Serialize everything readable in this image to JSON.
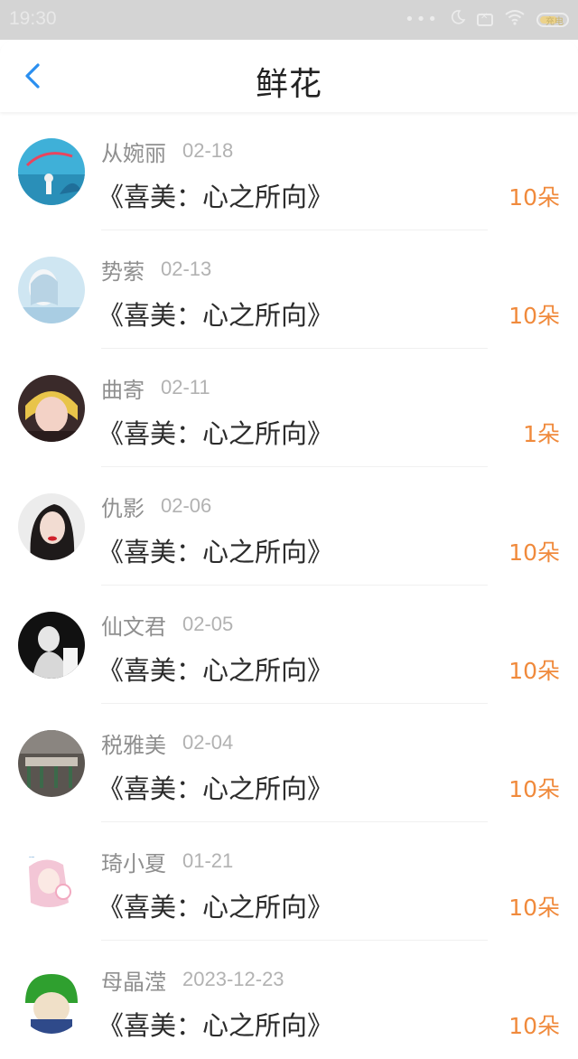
{
  "status_bar": {
    "time": "19:30",
    "icons": [
      "more-dots-icon",
      "moon-icon",
      "sim-off-icon",
      "wifi-icon",
      "battery-icon"
    ],
    "battery_label": "充电"
  },
  "header": {
    "title": "鲜花",
    "back_icon": "chevron-left-icon",
    "accent_color": "#2a8ff0"
  },
  "colors": {
    "amount": "#f08a3c",
    "name": "#8f8f8f",
    "date": "#b2b2b2"
  },
  "items": [
    {
      "name": "从婉丽",
      "date": "02-18",
      "title": "《喜美：心之所向》",
      "amount": "10朵"
    },
    {
      "name": "势萦",
      "date": "02-13",
      "title": "《喜美：心之所向》",
      "amount": "10朵"
    },
    {
      "name": "曲寄",
      "date": "02-11",
      "title": "《喜美：心之所向》",
      "amount": "1朵"
    },
    {
      "name": "仇影",
      "date": "02-06",
      "title": "《喜美：心之所向》",
      "amount": "10朵"
    },
    {
      "name": "仙文君",
      "date": "02-05",
      "title": "《喜美：心之所向》",
      "amount": "10朵"
    },
    {
      "name": "税雅美",
      "date": "02-04",
      "title": "《喜美：心之所向》",
      "amount": "10朵"
    },
    {
      "name": "琦小夏",
      "date": "01-21",
      "title": "《喜美：心之所向》",
      "amount": "10朵"
    },
    {
      "name": "母晶滢",
      "date": "2023-12-23",
      "title": "《喜美：心之所向》",
      "amount": "10朵"
    }
  ]
}
